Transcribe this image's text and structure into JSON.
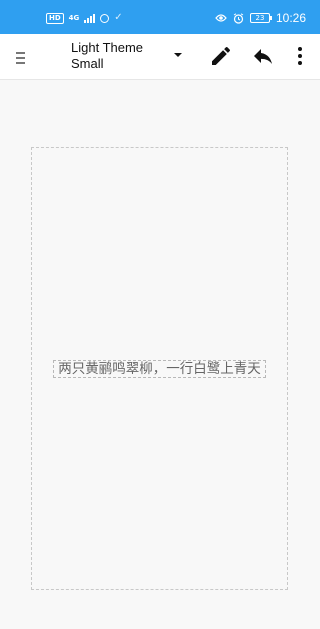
{
  "status_bar": {
    "hd_label": "HD",
    "network_label": "4G",
    "battery_level": "23",
    "time": "10:26",
    "icons": [
      "hd-icon",
      "signal-icon",
      "notification-icon",
      "check-icon",
      "eye-icon",
      "alarm-icon",
      "battery-icon"
    ]
  },
  "app_bar": {
    "theme_title": "Light Theme",
    "theme_size": "Small",
    "icons": [
      "menu-icon",
      "dropdown-arrow-icon",
      "edit-pencil-icon",
      "undo-icon",
      "more-vert-icon"
    ]
  },
  "canvas": {
    "text": "两只黄鹂鸣翠柳，一行白鹭上青天"
  },
  "colors": {
    "status_bar": "#2f9ff0",
    "app_bar": "#ffffff",
    "background": "#f8f8f8",
    "canvas_border": "#c8c8c8",
    "canvas_text": "#666666"
  }
}
